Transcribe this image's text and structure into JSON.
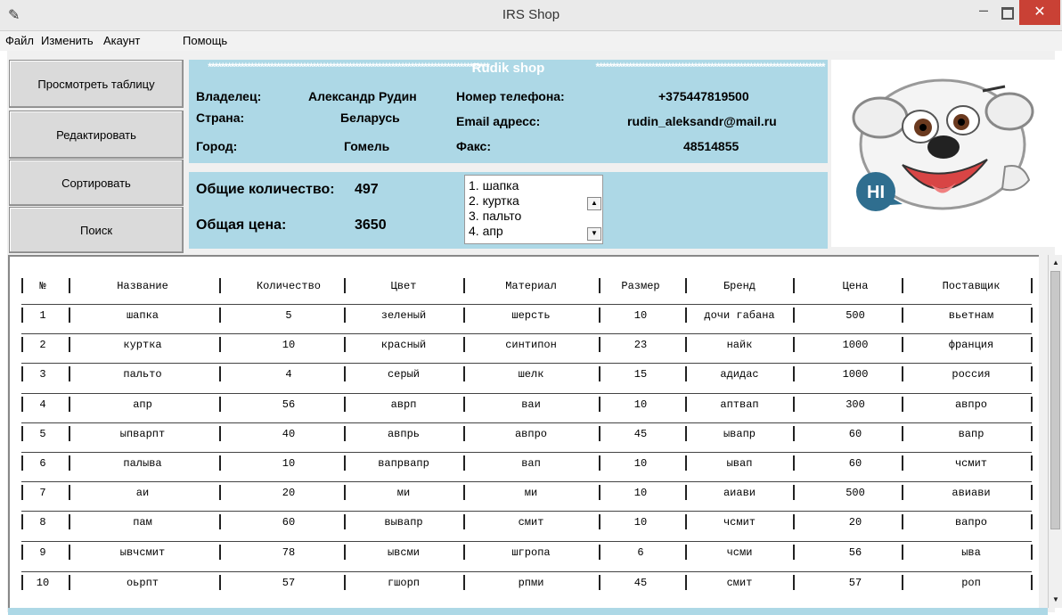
{
  "window": {
    "title": "IRS Shop",
    "minimize": "–",
    "close": "✕"
  },
  "menu": [
    "Файл",
    "Изменить",
    "Акаунт",
    "Помощь"
  ],
  "buttons": {
    "view": "Просмотреть таблицу",
    "edit": "Редактировать",
    "sort": "Сортировать",
    "search": "Поиск"
  },
  "shop": {
    "title": "Rudik shop",
    "owner_label": "Владелец:",
    "owner": "Александр Рудин",
    "country_label": "Страна:",
    "country": "Беларусь",
    "city_label": "Город:",
    "city": "Гомель",
    "phone_label": "Номер телефона:",
    "phone": "+375447819500",
    "email_label": "Email адресс:",
    "email": "rudin_aleksandr@mail.ru",
    "fax_label": "Факс:",
    "fax": "48514855"
  },
  "totals": {
    "count_label": "Общие количество:",
    "count": "497",
    "price_label": "Общая цена:",
    "price": "3650"
  },
  "listbox": [
    "1. шапка",
    "2. куртка",
    "3. пальто",
    "4. апр"
  ],
  "mascot": {
    "greeting": "HI",
    "icon": "dog-mascot"
  },
  "table": {
    "headers": [
      "№",
      "Название",
      "Количество",
      "Цвет",
      "Материал",
      "Размер",
      "Бренд",
      "Цена",
      "Поставщик"
    ],
    "rows": [
      [
        "1",
        "шапка",
        "5",
        "зеленый",
        "шерсть",
        "10",
        "дочи габана",
        "500",
        "вьетнам"
      ],
      [
        "2",
        "куртка",
        "10",
        "красный",
        "синтипон",
        "23",
        "найк",
        "1000",
        "франция"
      ],
      [
        "3",
        "пальто",
        "4",
        "серый",
        "шелк",
        "15",
        "адидас",
        "1000",
        "россия"
      ],
      [
        "4",
        "апр",
        "56",
        "аврп",
        "ваи",
        "10",
        "аптвап",
        "300",
        "авпро"
      ],
      [
        "5",
        "ыпварпт",
        "40",
        "авпрь",
        "авпро",
        "45",
        "ывапр",
        "60",
        "вапр"
      ],
      [
        "6",
        "палыва",
        "10",
        "вапрвапр",
        "вап",
        "10",
        "ывап",
        "60",
        "чсмит"
      ],
      [
        "7",
        "аи",
        "20",
        "ми",
        "ми",
        "10",
        "аиави",
        "500",
        "авиави"
      ],
      [
        "8",
        "пам",
        "60",
        "вывапр",
        "смит",
        "10",
        "чсмит",
        "20",
        "вапро"
      ],
      [
        "9",
        "ывчсмит",
        "78",
        "ывсми",
        "шгропа",
        "6",
        "чсми",
        "56",
        "ыва"
      ],
      [
        "10",
        "оьрпт",
        "57",
        "гшорп",
        "рпми",
        "45",
        "смит",
        "57",
        "роп"
      ]
    ]
  }
}
